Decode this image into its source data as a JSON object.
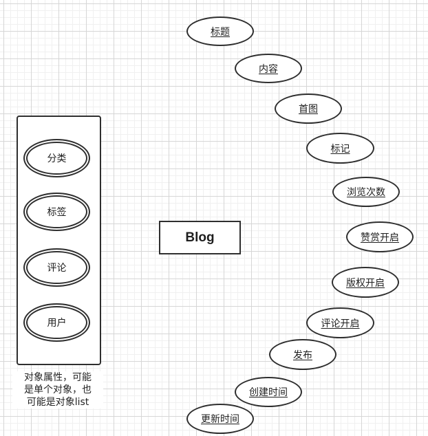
{
  "entity": {
    "label": "Blog"
  },
  "attributes": [
    {
      "label": "标题"
    },
    {
      "label": "内容"
    },
    {
      "label": "首图"
    },
    {
      "label": "标记"
    },
    {
      "label": "浏览次数"
    },
    {
      "label": "赞赏开启"
    },
    {
      "label": "版权开启"
    },
    {
      "label": "评论开启"
    },
    {
      "label": "发布"
    },
    {
      "label": "创建时间"
    },
    {
      "label": "更新时间"
    }
  ],
  "object_attributes": [
    {
      "label": "分类"
    },
    {
      "label": "标签"
    },
    {
      "label": "评论"
    },
    {
      "label": "用户"
    }
  ],
  "note": {
    "line1": "对象属性，可能",
    "line2": "是单个对象，也",
    "line3": "可能是对象list"
  }
}
